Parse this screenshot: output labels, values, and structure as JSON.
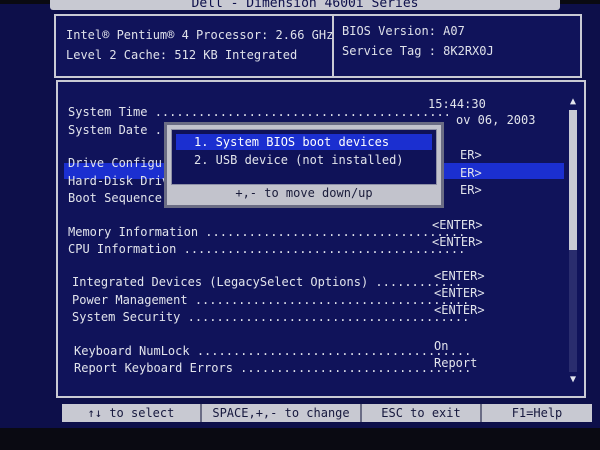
{
  "header": {
    "title": "Dell - Dimension 4600i Series",
    "processor": "Intel® Pentium® 4 Processor:  2.66 GHz",
    "cache": "Level 2 Cache:  512 KB Integrated",
    "bios_version": "BIOS Version: A07",
    "service_tag": "Service Tag : 8K2RX0J"
  },
  "menu": {
    "items": [
      {
        "label": "System Time .........................................",
        "value": "15:44:30"
      },
      {
        "label": "System Date ...",
        "value": "ov 06, 2003"
      },
      {
        "label": "Drive Configura",
        "value": "ER>"
      },
      {
        "label": "Hard-Disk Drive",
        "value": "ER>"
      },
      {
        "label": "Boot Sequence .",
        "value": "ER>"
      },
      {
        "label": "Memory Information ....................................",
        "value": "<ENTER>"
      },
      {
        "label": "CPU Information .......................................",
        "value": "<ENTER>"
      },
      {
        "label": "Integrated Devices (LegacySelect Options) ............",
        "value": "<ENTER>"
      },
      {
        "label": "Power Management ......................................",
        "value": "<ENTER>"
      },
      {
        "label": "System Security .......................................",
        "value": "<ENTER>"
      },
      {
        "label": "Keyboard NumLock ......................................",
        "value": "On"
      },
      {
        "label": "Report Keyboard Errors ................................",
        "value": "Report"
      }
    ],
    "scroll_up": "▲",
    "scroll_down": "▼"
  },
  "popup": {
    "items": [
      "1. System BIOS boot devices",
      "2. USB device (not installed)"
    ],
    "selected_index": 0,
    "hint": "+,- to move down/up"
  },
  "footer": {
    "items": [
      "↑↓ to select",
      "SPACE,+,- to change",
      "ESC to exit",
      "F1=Help"
    ]
  },
  "colors": {
    "background": "#0d0f4a",
    "highlight": "#1b2fd0",
    "panel_border": "#c9cad4",
    "footer_bg": "#c8c9d2"
  }
}
